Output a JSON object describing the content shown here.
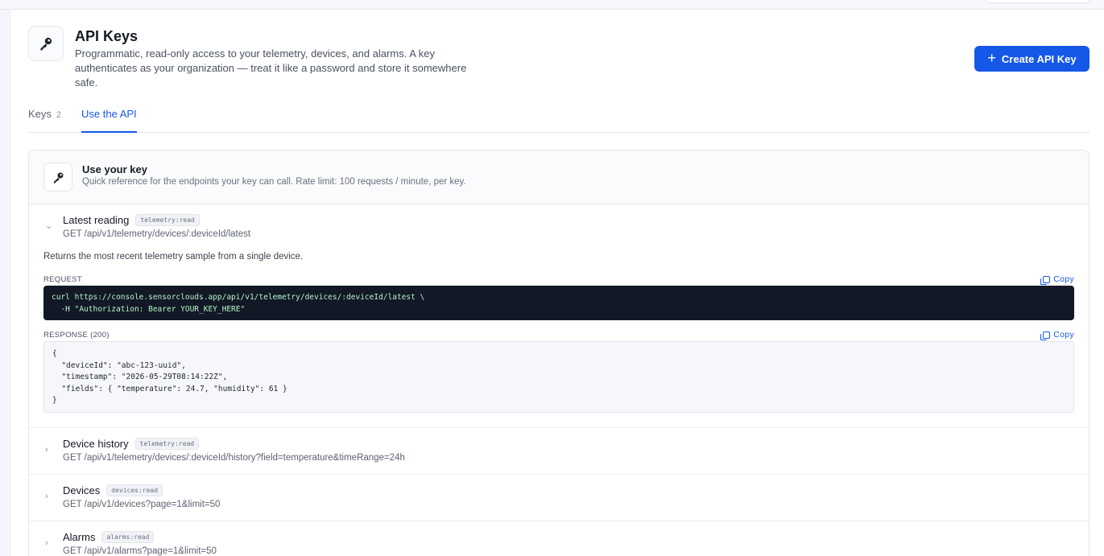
{
  "header": {
    "title": "API Keys",
    "description": "Programmatic, read-only access to your telemetry, devices, and alarms. A key authenticates as your organization — treat it like a password and store it somewhere safe.",
    "create_button": "Create API Key"
  },
  "tabs": [
    {
      "label": "Keys",
      "count": "2",
      "active": false
    },
    {
      "label": "Use the API",
      "active": true
    }
  ],
  "card": {
    "title": "Use your key",
    "subtitle": "Quick reference for the endpoints your key can call. Rate limit: 100 requests / minute, per key."
  },
  "endpoints": [
    {
      "name": "Latest reading",
      "scope": "telemetry:read",
      "path": "GET /api/v1/telemetry/devices/:deviceId/latest",
      "expanded": true,
      "description": "Returns the most recent telemetry sample from a single device.",
      "request_label": "REQUEST",
      "request_code": "curl https://console.sensorclouds.app/api/v1/telemetry/devices/:deviceId/latest \\\n  -H \"Authorization: Bearer YOUR_KEY_HERE\"",
      "response_label": "RESPONSE (200)",
      "response_code": "{\n  \"deviceId\": \"abc-123-uuid\",\n  \"timestamp\": \"2026-05-29T08:14:22Z\",\n  \"fields\": { \"temperature\": 24.7, \"humidity\": 61 }\n}",
      "copy_label": "Copy"
    },
    {
      "name": "Device history",
      "scope": "telemetry:read",
      "path": "GET /api/v1/telemetry/devices/:deviceId/history?field=temperature&timeRange=24h",
      "expanded": false
    },
    {
      "name": "Devices",
      "scope": "devices:read",
      "path": "GET /api/v1/devices?page=1&limit=50",
      "expanded": false
    },
    {
      "name": "Alarms",
      "scope": "alarms:read",
      "path": "GET /api/v1/alarms?page=1&limit=50",
      "expanded": false
    }
  ],
  "colors": {
    "accent": "#1558e8",
    "code_bg": "#121826",
    "code_text": "#b7f5c9"
  }
}
